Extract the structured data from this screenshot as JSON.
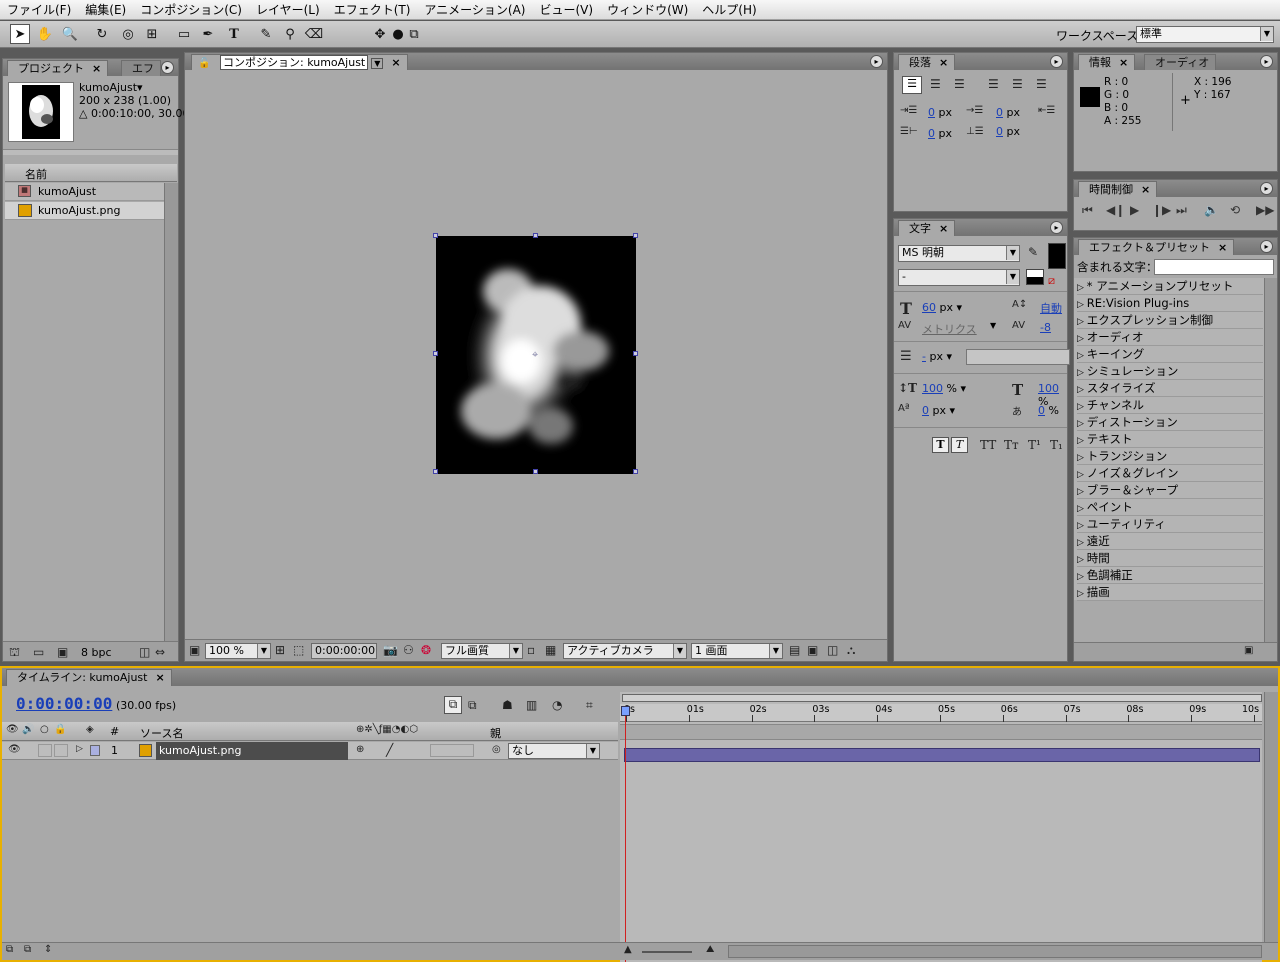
{
  "menu": [
    "ファイル(F)",
    "編集(E)",
    "コンポジション(C)",
    "レイヤー(L)",
    "エフェクト(T)",
    "アニメーション(A)",
    "ビュー(V)",
    "ウィンドウ(W)",
    "ヘルプ(H)"
  ],
  "workspace": {
    "label": "ワークスペース：",
    "value": "標準"
  },
  "project": {
    "tab": "プロジェクト",
    "tab2": "エフ",
    "item_name": "kumoAjust▾",
    "item_size": "200 x 238 (1.00)",
    "item_duration": "△ 0:00:10:00, 30.00",
    "col_name": "名前",
    "items": [
      "kumoAjust",
      "kumoAjust.png"
    ],
    "bpc": "8 bpc"
  },
  "comp": {
    "tab": "コンポジション: kumoAjust",
    "zoom": "100 %",
    "timecode": "0:00:00:00",
    "quality": "フル画質",
    "camera": "アクティブカメラ",
    "views": "1 画面"
  },
  "paragraph": {
    "tab": "段落",
    "v1": "0",
    "v2": "0",
    "v3": "0",
    "v4": "0",
    "v5": "0",
    "unit": "px"
  },
  "info": {
    "tab": "情報",
    "tab2": "オーディオ",
    "r": "R : 0",
    "g": "G : 0",
    "b": "B : 0",
    "a": "A : 255",
    "x": "X : 196",
    "y": "Y : 167"
  },
  "time_controls": {
    "tab": "時間制御"
  },
  "effects": {
    "tab": "エフェクト＆プリセット",
    "contains_label": "含まれる文字：",
    "items": [
      "* アニメーションプリセット",
      "RE:Vision Plug-ins",
      "エクスプレッション制御",
      "オーディオ",
      "キーイング",
      "シミュレーション",
      "スタイライズ",
      "チャンネル",
      "ディストーション",
      "テキスト",
      "トランジション",
      "ノイズ＆グレイン",
      "ブラー＆シャープ",
      "ペイント",
      "ユーティリティ",
      "遠近",
      "時間",
      "色調補正",
      "描画"
    ]
  },
  "character": {
    "tab": "文字",
    "font": "MS 明朝",
    "style": "-",
    "size": "60",
    "size_unit": "px",
    "leading": "自動",
    "kerning": "メトリクス",
    "tracking": "-8",
    "stroke_unit": "px",
    "vscale": "100",
    "vscale_unit": "%",
    "hscale": "100",
    "hscale_unit": "%",
    "baseline": "0",
    "baseline_unit": "px",
    "tsume": "0",
    "tsume_unit": "%"
  },
  "timeline": {
    "tab": "タイムライン: kumoAjust",
    "timecode": "0:00:00:00",
    "fps": "(30.00 fps)",
    "col_num": "#",
    "col_source": "ソース名",
    "col_parent": "親",
    "layer_num": "1",
    "layer_name": "kumoAjust.png",
    "parent_value": "なし",
    "ruler": [
      "0s",
      "01s",
      "02s",
      "03s",
      "04s",
      "05s",
      "06s",
      "07s",
      "08s",
      "09s",
      "10s"
    ]
  },
  "colors": {
    "accent_gold": "#e8b000",
    "layer_bar": "#6a65a8",
    "playhead": "#d02020",
    "timecode_blue": "#1a3fb8"
  }
}
